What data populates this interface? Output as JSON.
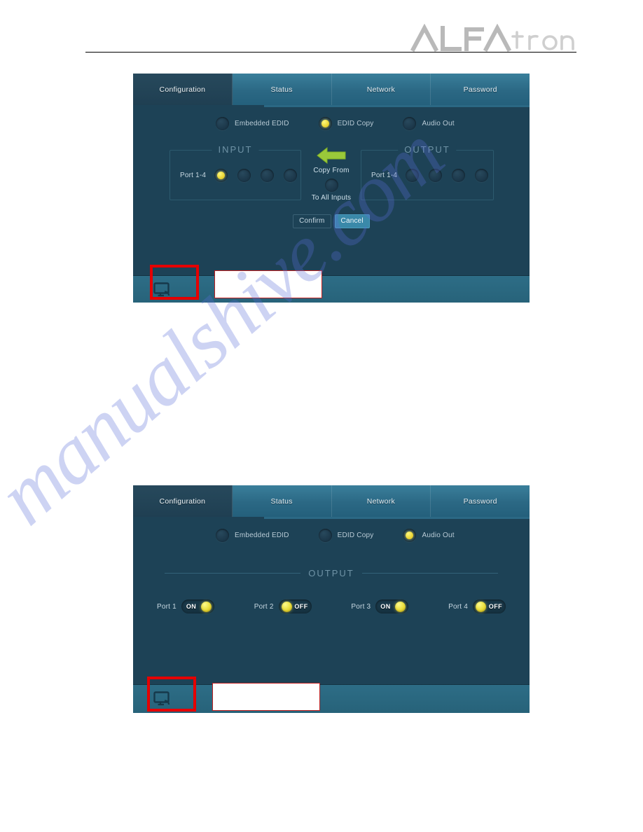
{
  "header": {
    "brand_primary": "ALFA",
    "brand_secondary": "tron",
    "brand_full": "ALFAtron"
  },
  "watermark": {
    "text": "manualshive.com"
  },
  "colors": {
    "panel_bg": "#1d4256",
    "tab_active_bg": "#27495c",
    "tab_inactive_bg": "#2b6884",
    "footer_bg": "#2d6d86",
    "accent_yellow": "#ecd83a",
    "arrow_green": "#9ac93a",
    "highlight_red": "#e50000",
    "cancel_blue": "#3a89a9"
  },
  "panels": [
    {
      "id": "edid-copy-panel",
      "tabs": [
        {
          "label": "Configuration",
          "active": true
        },
        {
          "label": "Status",
          "active": false
        },
        {
          "label": "Network",
          "active": false
        },
        {
          "label": "Password",
          "active": false
        }
      ],
      "modes": [
        {
          "label": "Embedded EDID",
          "selected": false
        },
        {
          "label": "EDID Copy",
          "selected": true
        },
        {
          "label": "Audio Out",
          "selected": false
        }
      ],
      "input_group": {
        "legend": "INPUT",
        "port_label": "Port 1-4",
        "ports": [
          {
            "selected": true
          },
          {
            "selected": false
          },
          {
            "selected": false
          },
          {
            "selected": false
          }
        ]
      },
      "copy_column": {
        "arrow_icon": "arrow-left-icon",
        "copy_from_label": "Copy From",
        "to_all_inputs_label": "To All Inputs",
        "to_all_inputs_selected": false
      },
      "output_group": {
        "legend": "OUTPUT",
        "port_label": "Port 1-4",
        "ports": [
          {
            "selected": false
          },
          {
            "selected": false
          },
          {
            "selected": false
          },
          {
            "selected": false
          }
        ]
      },
      "buttons": {
        "confirm_label": "Confirm",
        "cancel_label": "Cancel"
      },
      "footer": {
        "icon": "display-monitor-icon",
        "blank_field_value": ""
      }
    },
    {
      "id": "audio-out-panel",
      "tabs": [
        {
          "label": "Configuration",
          "active": true
        },
        {
          "label": "Status",
          "active": false
        },
        {
          "label": "Network",
          "active": false
        },
        {
          "label": "Password",
          "active": false
        }
      ],
      "modes": [
        {
          "label": "Embedded EDID",
          "selected": false
        },
        {
          "label": "EDID Copy",
          "selected": false
        },
        {
          "label": "Audio Out",
          "selected": true
        }
      ],
      "output_section": {
        "legend": "OUTPUT",
        "toggles": [
          {
            "port_label": "Port 1",
            "state_label": "ON",
            "on": true
          },
          {
            "port_label": "Port 2",
            "state_label": "OFF",
            "on": false
          },
          {
            "port_label": "Port 3",
            "state_label": "ON",
            "on": true
          },
          {
            "port_label": "Port 4",
            "state_label": "OFF",
            "on": false
          }
        ]
      },
      "footer": {
        "icon": "display-monitor-icon",
        "blank_field_value": ""
      }
    }
  ]
}
